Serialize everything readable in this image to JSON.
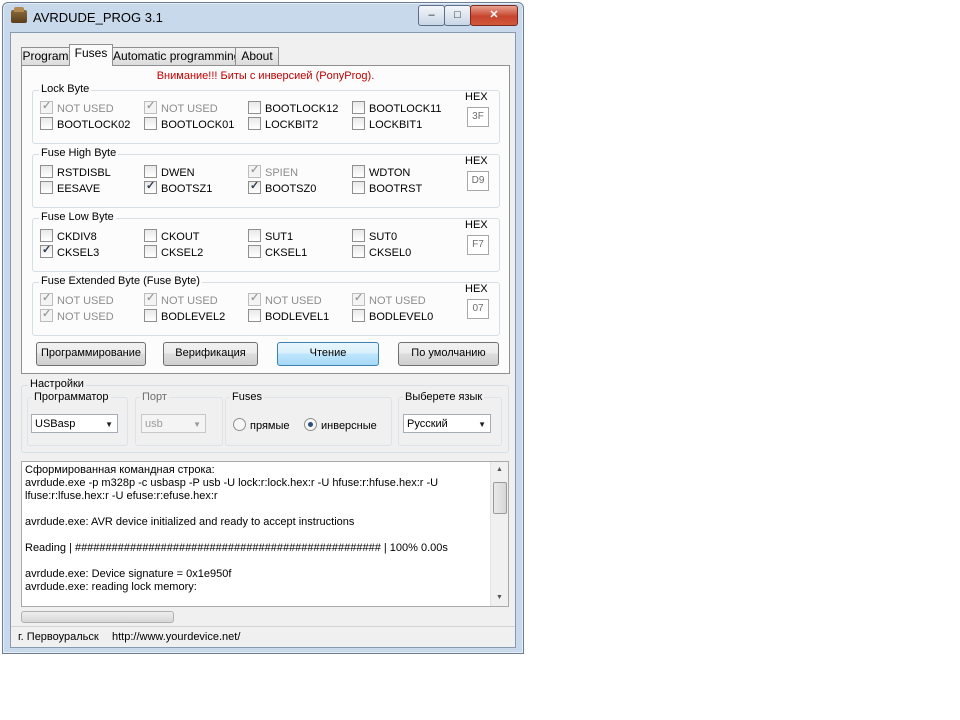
{
  "window": {
    "title": "AVRDUDE_PROG 3.1",
    "min_label": "‒",
    "max_label": "□",
    "close_label": "✕"
  },
  "tabs": [
    {
      "label": "Program"
    },
    {
      "label": "Fuses"
    },
    {
      "label": "Automatic programming"
    },
    {
      "label": "About"
    }
  ],
  "fuses": {
    "warning": "Внимание!!! Биты с инверсией (PonyProg).",
    "hex_label": "HEX",
    "lock": {
      "title": "Lock Byte",
      "hex": "3F",
      "bits": [
        {
          "label": "NOT USED",
          "checked": true,
          "disabled": true
        },
        {
          "label": "NOT USED",
          "checked": true,
          "disabled": true
        },
        {
          "label": "BOOTLOCK12",
          "checked": false,
          "disabled": false
        },
        {
          "label": "BOOTLOCK11",
          "checked": false,
          "disabled": false
        },
        {
          "label": "BOOTLOCK02",
          "checked": false,
          "disabled": false
        },
        {
          "label": "BOOTLOCK01",
          "checked": false,
          "disabled": false
        },
        {
          "label": "LOCKBIT2",
          "checked": false,
          "disabled": false
        },
        {
          "label": "LOCKBIT1",
          "checked": false,
          "disabled": false
        }
      ]
    },
    "high": {
      "title": "Fuse High Byte",
      "hex": "D9",
      "bits": [
        {
          "label": "RSTDISBL",
          "checked": false,
          "disabled": false
        },
        {
          "label": "DWEN",
          "checked": false,
          "disabled": false
        },
        {
          "label": "SPIEN",
          "checked": true,
          "disabled": true
        },
        {
          "label": "WDTON",
          "checked": false,
          "disabled": false
        },
        {
          "label": "EESAVE",
          "checked": false,
          "disabled": false
        },
        {
          "label": "BOOTSZ1",
          "checked": true,
          "disabled": false
        },
        {
          "label": "BOOTSZ0",
          "checked": true,
          "disabled": false
        },
        {
          "label": "BOOTRST",
          "checked": false,
          "disabled": false
        }
      ]
    },
    "low": {
      "title": "Fuse Low Byte",
      "hex": "F7",
      "bits": [
        {
          "label": "CKDIV8",
          "checked": false,
          "disabled": false
        },
        {
          "label": "CKOUT",
          "checked": false,
          "disabled": false
        },
        {
          "label": "SUT1",
          "checked": false,
          "disabled": false
        },
        {
          "label": "SUT0",
          "checked": false,
          "disabled": false
        },
        {
          "label": "CKSEL3",
          "checked": true,
          "disabled": false
        },
        {
          "label": "CKSEL2",
          "checked": false,
          "disabled": false
        },
        {
          "label": "CKSEL1",
          "checked": false,
          "disabled": false
        },
        {
          "label": "CKSEL0",
          "checked": false,
          "disabled": false
        }
      ]
    },
    "ext": {
      "title": "Fuse Extended Byte (Fuse Byte)",
      "hex": "07",
      "bits": [
        {
          "label": "NOT USED",
          "checked": true,
          "disabled": true
        },
        {
          "label": "NOT USED",
          "checked": true,
          "disabled": true
        },
        {
          "label": "NOT USED",
          "checked": true,
          "disabled": true
        },
        {
          "label": "NOT USED",
          "checked": true,
          "disabled": true
        },
        {
          "label": "NOT USED",
          "checked": true,
          "disabled": true
        },
        {
          "label": "BODLEVEL2",
          "checked": false,
          "disabled": false
        },
        {
          "label": "BODLEVEL1",
          "checked": false,
          "disabled": false
        },
        {
          "label": "BODLEVEL0",
          "checked": false,
          "disabled": false
        }
      ]
    },
    "buttons": {
      "program": "Программирование",
      "verify": "Верификация",
      "read": "Чтение",
      "default": "По умолчанию"
    }
  },
  "settings": {
    "title": "Настройки",
    "programmer": {
      "label": "Программатор",
      "value": "USBasp"
    },
    "port": {
      "label": "Порт",
      "value": "usb"
    },
    "fuses_mode": {
      "label": "Fuses",
      "option_direct": "прямые",
      "option_inverse": "инверсные",
      "selected": "инверсные"
    },
    "language": {
      "label": "Выберете язык",
      "value": "Русский"
    }
  },
  "log": {
    "lines": [
      "Сформированная командная строка:",
      "avrdude.exe -p m328p -c usbasp -P usb  -U lock:r:lock.hex:r -U hfuse:r:hfuse.hex:r -U",
      "lfuse:r:lfuse.hex:r -U efuse:r:efuse.hex:r",
      "",
      "avrdude.exe: AVR device initialized and ready to accept instructions",
      "",
      "Reading | ################################################## | 100% 0.00s",
      "",
      "avrdude.exe: Device signature = 0x1e950f",
      "avrdude.exe: reading lock memory:"
    ]
  },
  "status": {
    "city": "г. Первоуральск",
    "url": "http://www.yourdevice.net/"
  }
}
